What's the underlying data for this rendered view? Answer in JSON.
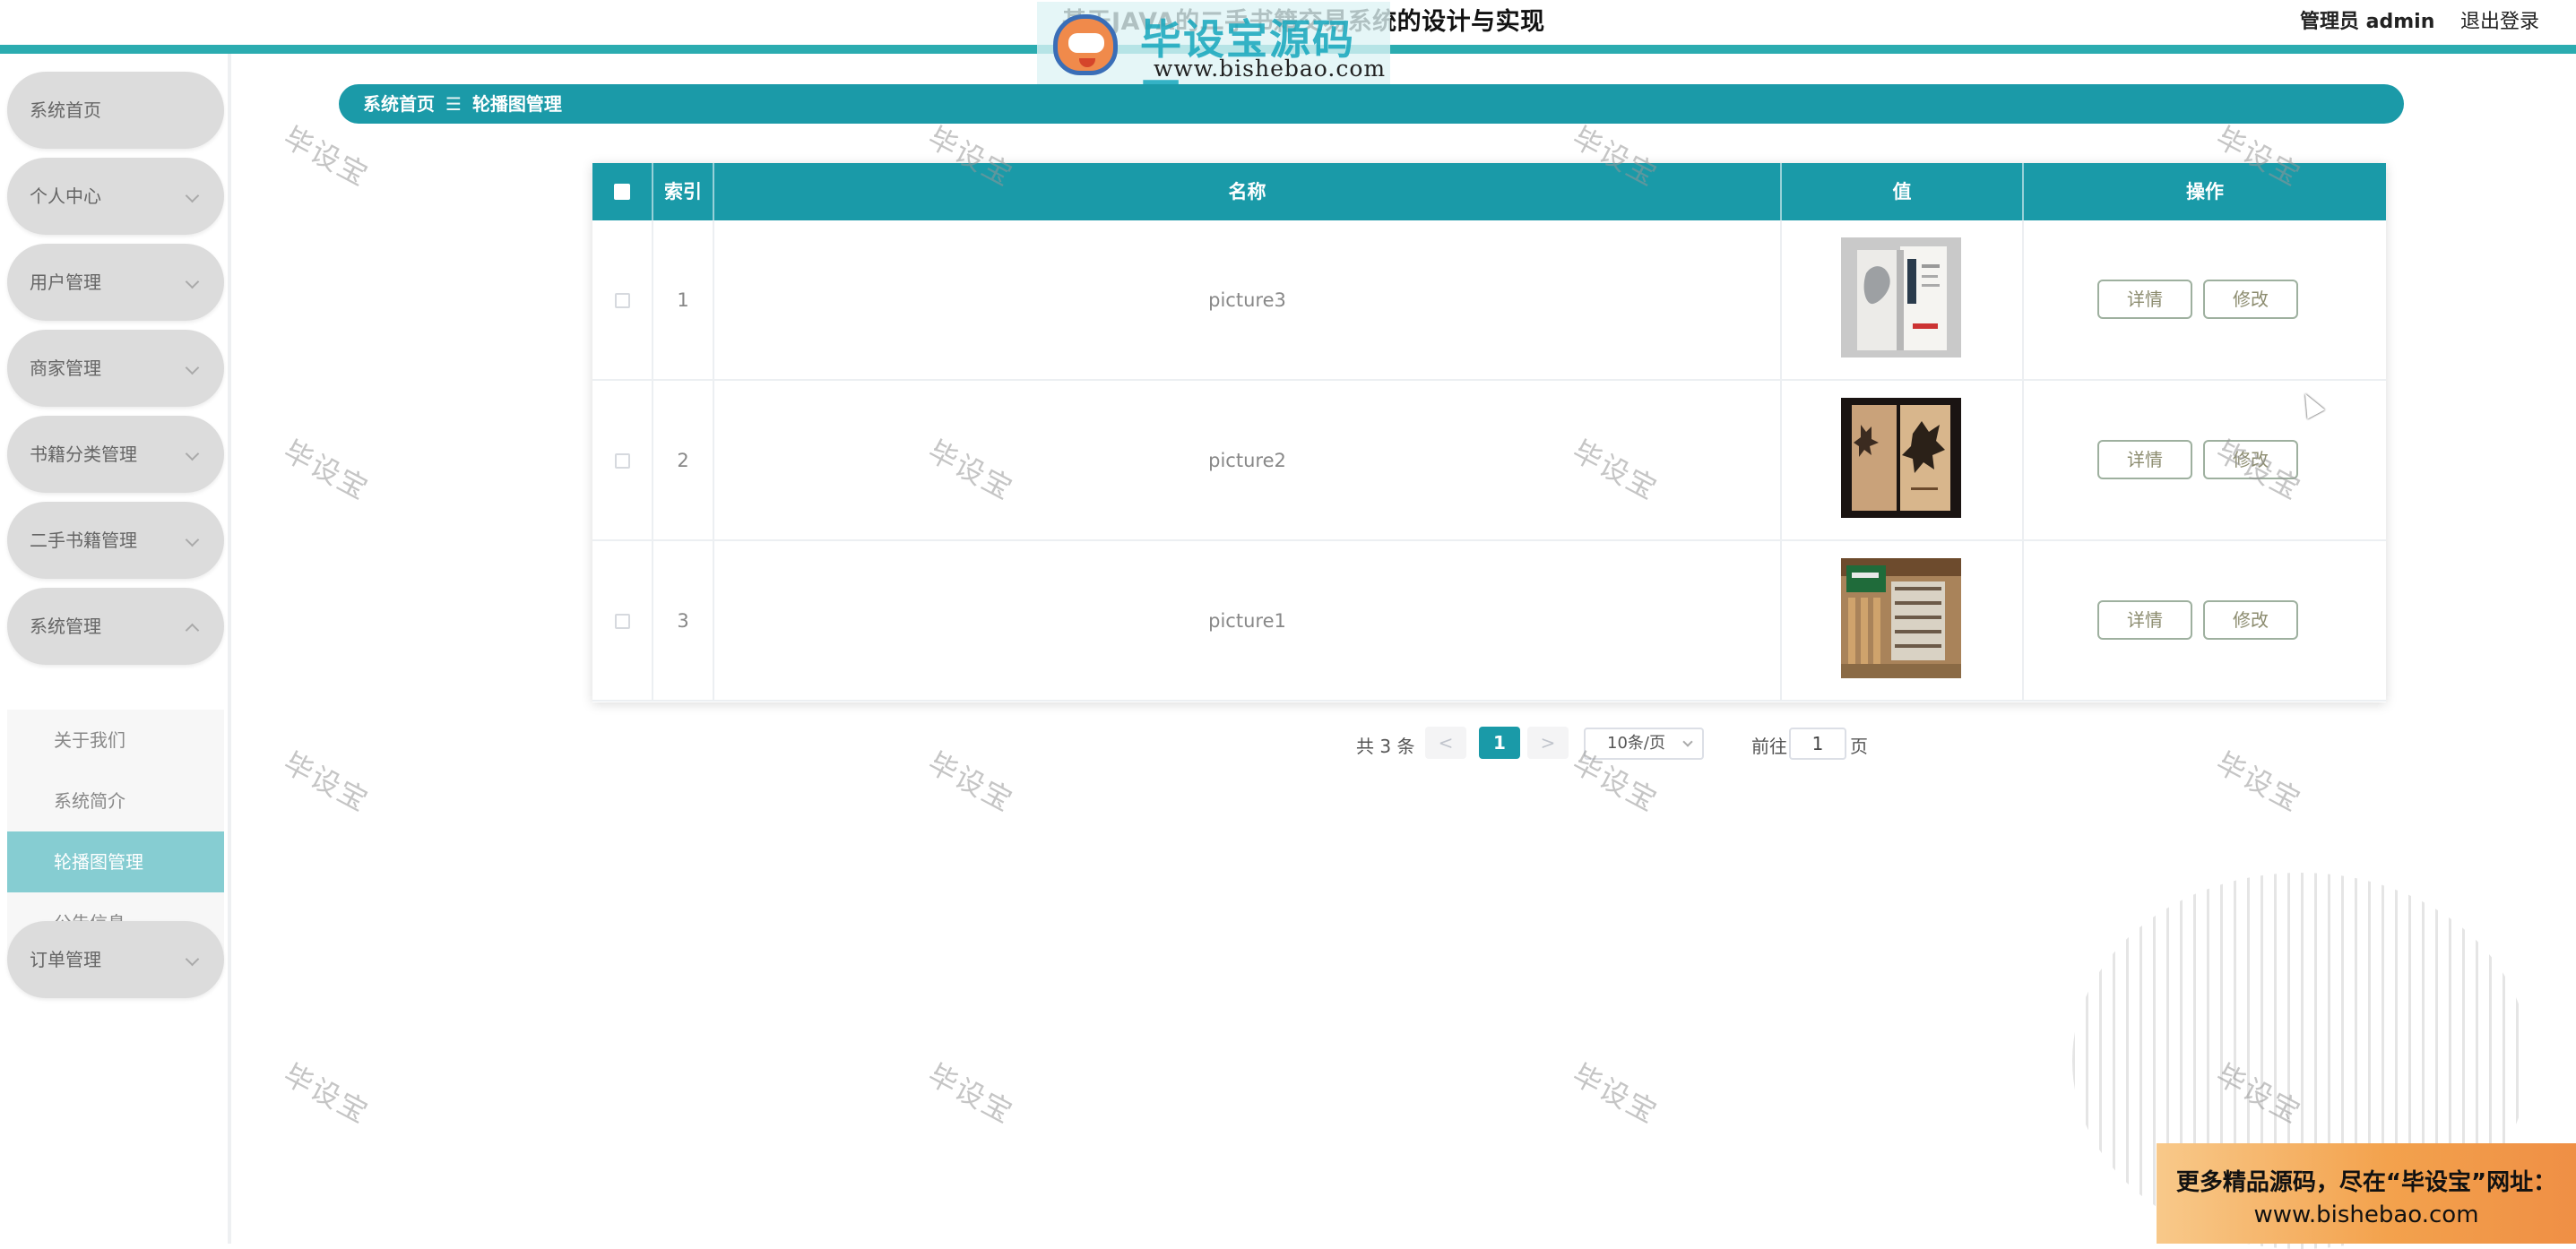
{
  "header": {
    "app_title": "基于JAVA的二手书籍交易系统的设计与实现",
    "watermark_logo": {
      "name": "毕设宝源码网",
      "url": "www.bishebao.com"
    },
    "admin_label": "管理员 admin",
    "logout_label": "退出登录",
    "accent_color": "#2bacb0"
  },
  "sidebar": {
    "items": [
      {
        "label": "系统首页",
        "icon": "none"
      },
      {
        "label": "个人中心",
        "icon": "chevron-down-icon"
      },
      {
        "label": "用户管理",
        "icon": "chevron-down-icon"
      },
      {
        "label": "商家管理",
        "icon": "chevron-down-icon"
      },
      {
        "label": "书籍分类管理",
        "icon": "chevron-down-icon"
      },
      {
        "label": "二手书籍管理",
        "icon": "chevron-down-icon"
      },
      {
        "label": "系统管理",
        "icon": "chevron-up-icon",
        "expanded": true
      },
      {
        "label": "订单管理",
        "icon": "chevron-down-icon"
      }
    ],
    "submenu": [
      {
        "label": "关于我们",
        "active": false
      },
      {
        "label": "系统简介",
        "active": false
      },
      {
        "label": "轮播图管理",
        "active": true
      },
      {
        "label": "公告信息",
        "active": false
      }
    ]
  },
  "breadcrumb": {
    "home": "系统首页",
    "separator": "☰",
    "current": "轮播图管理"
  },
  "table": {
    "columns": [
      "索引",
      "名称",
      "值",
      "操作"
    ],
    "header_color": "#1a9aa8",
    "rows": [
      {
        "index": "1",
        "name": "picture3",
        "image": "book-spread-thumbnail",
        "detail_label": "详情",
        "edit_label": "修改"
      },
      {
        "index": "2",
        "name": "picture2",
        "image": "book-cover-thumbnail",
        "detail_label": "详情",
        "edit_label": "修改"
      },
      {
        "index": "3",
        "name": "picture1",
        "image": "bookstore-thumbnail",
        "detail_label": "详情",
        "edit_label": "修改"
      }
    ]
  },
  "pagination": {
    "total_label": "共 3 条",
    "prev": "<",
    "current_page": "1",
    "next": ">",
    "page_size": "10条/页",
    "goto_label": "前往",
    "goto_value": "1",
    "page_suffix": "页"
  },
  "watermark_text": "毕设宝",
  "ad_banner": {
    "line1": "更多精品源码，尽在“毕设宝”网址：",
    "line2": "www.bishebao.com"
  }
}
